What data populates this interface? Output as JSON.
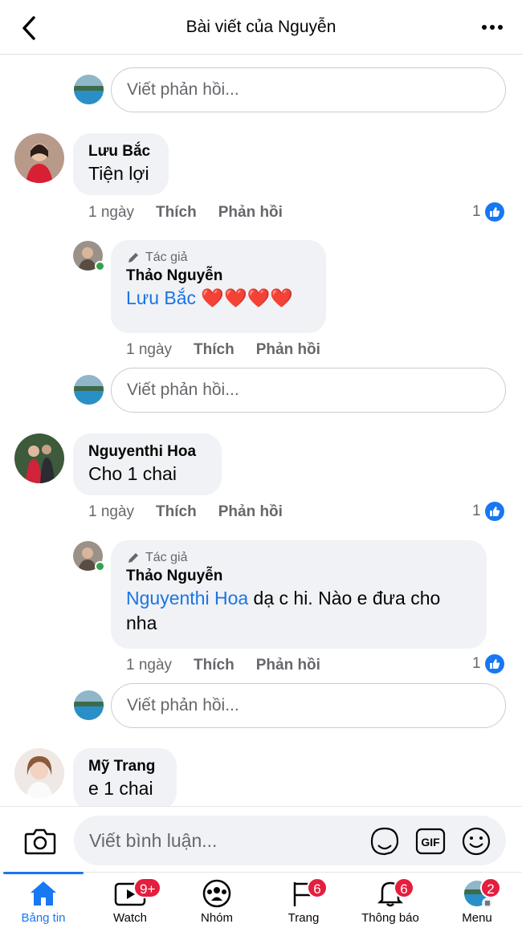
{
  "header": {
    "title": "Bài viết của Nguyễn"
  },
  "reply_placeholder": "Viết phản hồi...",
  "comments": [
    {
      "name": "Lưu Bắc",
      "text": "Tiện lợi",
      "time": "1 ngày",
      "like_label": "Thích",
      "reply_label": "Phản hồi",
      "reactions": "1",
      "reply": {
        "author_badge": "Tác giả",
        "name": "Thảo Nguyễn",
        "mention": "Lưu Bắc",
        "text": "❤️❤️❤️❤️",
        "time": "1 ngày",
        "like_label": "Thích",
        "reply_label": "Phản hồi"
      }
    },
    {
      "name": "Nguyenthi Hoa",
      "text": "Cho 1 chai",
      "time": "1 ngày",
      "like_label": "Thích",
      "reply_label": "Phản hồi",
      "reactions": "1",
      "reply": {
        "author_badge": "Tác giả",
        "name": "Thảo Nguyễn",
        "mention": "Nguyenthi Hoa",
        "text": " dạ c hi. Nào e đưa cho nha",
        "time": "1 ngày",
        "like_label": "Thích",
        "reply_label": "Phản hồi",
        "reactions": "1"
      }
    },
    {
      "name": "Mỹ Trang",
      "text": "e 1 chai"
    }
  ],
  "composer": {
    "placeholder": "Viết bình luận...",
    "gif_label": "GIF"
  },
  "tabs": [
    {
      "label": "Bảng tin",
      "icon": "home-icon"
    },
    {
      "label": "Watch",
      "icon": "watch-icon",
      "badge": "9+"
    },
    {
      "label": "Nhóm",
      "icon": "groups-icon"
    },
    {
      "label": "Trang",
      "icon": "flag-icon",
      "badge": "6"
    },
    {
      "label": "Thông báo",
      "icon": "bell-icon",
      "badge": "6"
    },
    {
      "label": "Menu",
      "icon": "menu-avatar-icon",
      "badge": "2"
    }
  ],
  "colors": {
    "accent": "#1877f2",
    "badge": "#e41e3f",
    "mention": "#1b74e4"
  }
}
